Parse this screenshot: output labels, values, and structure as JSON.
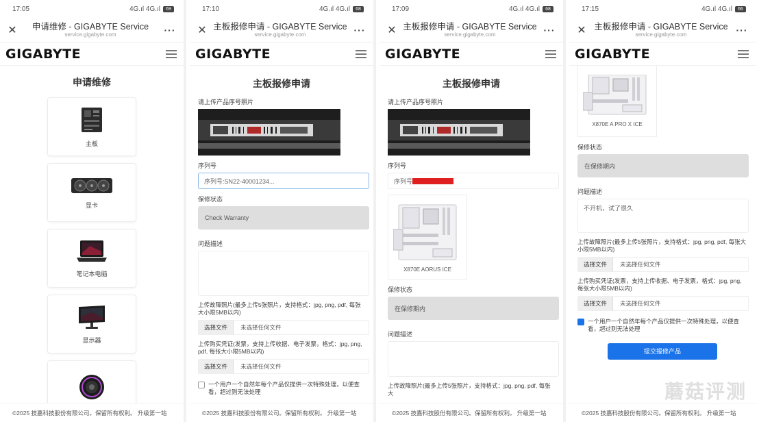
{
  "panels": [
    {
      "status": {
        "time": "17:05",
        "right": "4G.ıl 4G.ıl",
        "battery": "69"
      },
      "window": {
        "title": "申请维修 - GIGABYTE Service",
        "url": "service.gigabyte.com"
      },
      "brand": "GIGABYTE",
      "page_title": "申请维修",
      "categories": [
        {
          "label": "主板",
          "icon": "motherboard-icon"
        },
        {
          "label": "显卡",
          "icon": "graphics-card-icon"
        },
        {
          "label": "笔记本电脑",
          "icon": "laptop-icon"
        },
        {
          "label": "显示器",
          "icon": "monitor-icon"
        },
        {
          "label": "",
          "icon": "cooler-icon"
        }
      ],
      "footer": "©2025 技嘉科技股份有限公司。保留所有权利。 升级第一站"
    },
    {
      "status": {
        "time": "17:10",
        "right": "4G.ıl 4G.ıl",
        "battery": "68"
      },
      "window": {
        "title": "主板报修申请 - GIGABYTE Service",
        "url": "service.gigabyte.com"
      },
      "brand": "GIGABYTE",
      "page_title": "主板报修申请",
      "photo_label": "请上传产品序号照片",
      "sn_label": "序列号",
      "sn_value": "序列号:SN22-40001234...",
      "warranty_label": "保修状态",
      "warranty_value": "Check Warranty",
      "desc_label": "问题描述",
      "upload1_note": "上传故障照片(最多上传5张照片，支持格式：jpg, png, pdf, 每张大小限5MB以内)",
      "upload1_button": "选择文件",
      "upload1_text": "未选择任何文件",
      "upload2_note": "上传购买凭证(发票，支持上传收据、电子发票，格式：jpg, png, pdf, 每张大小限5MB以内)",
      "upload2_button": "选择文件",
      "upload2_text": "未选择任何文件",
      "consent": "一个用户一个自然年每个产品仅提供一次特殊处理，以便查看，超过则无法处理",
      "footer": "©2025 技嘉科技股份有限公司。保留所有权利。 升级第一站"
    },
    {
      "status": {
        "time": "17:09",
        "right": "4G.ıl 4G.ıl",
        "battery": "68"
      },
      "window": {
        "title": "主板报修申请 - GIGABYTE Service",
        "url": "service.gigabyte.com"
      },
      "brand": "GIGABYTE",
      "page_title": "主板报修申请",
      "photo_label": "请上传产品序号照片",
      "sn_label": "序列号",
      "sn_prefix": "序列号",
      "model_caption": "X870E AORUS ICE",
      "warranty_label": "保修状态",
      "warranty_value": "在保修期内",
      "desc_label": "问题描述",
      "upload_note": "上传故障照片(最多上传5张照片，支持格式：jpg, png, pdf, 每张大",
      "footer": "©2025 技嘉科技股份有限公司。保留所有权利。 升级第一站"
    },
    {
      "status": {
        "time": "17:15",
        "right": "4G.ıl 4G.ıl",
        "battery": "66"
      },
      "window": {
        "title": "主板报修申请 - GIGABYTE Service",
        "url": "service.gigabyte.com"
      },
      "brand": "GIGABYTE",
      "model_caption": "X870E A PRO X ICE",
      "warranty_label": "保修状态",
      "warranty_value": "在保修期内",
      "desc_label": "问题描述",
      "desc_value": "不开机，试了很久",
      "upload1_note": "上传故障照片(最多上传5张照片，支持格式：jpg, png, pdf, 每张大小限5MB以内)",
      "upload1_button": "选择文件",
      "upload1_text": "未选择任何文件",
      "upload2_note": "上传购买凭证(发票，支持上传收据、电子发票，格式：jpg, png, 每张大小限5MB以内)",
      "upload2_button": "选择文件",
      "upload2_text": "未选择任何文件",
      "consent": "一个用户一个自然年每个产品仅提供一次特殊处理，以便查看，超过则无法处理",
      "submit": "提交报修产品",
      "footer": "©2025 技嘉科技股份有限公司。保留所有权利。 升级第一站"
    }
  ],
  "watermark": "蘑菇评测",
  "colors": {
    "accent": "#1a73e8",
    "redaction": "#e02020",
    "select_bg": "#dedede"
  }
}
